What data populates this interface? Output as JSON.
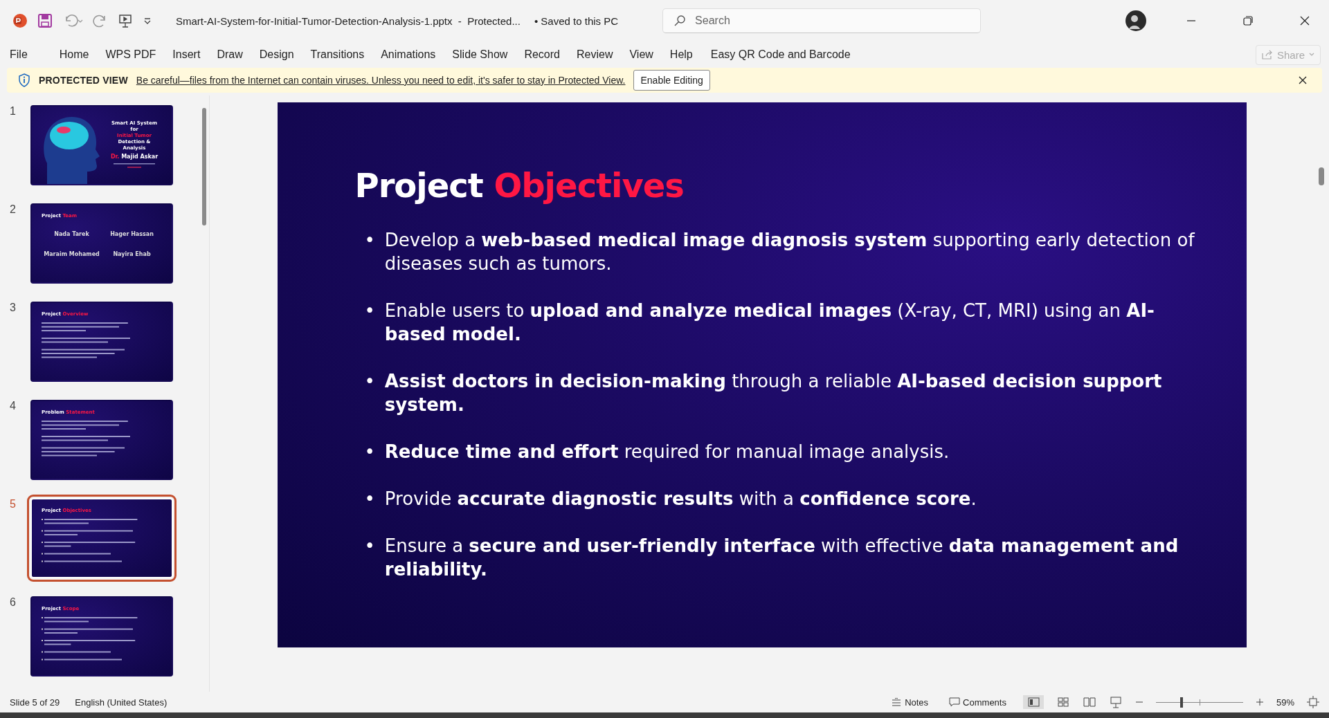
{
  "window": {
    "title": "Smart-AI-System-for-Initial-Tumor-Detection-Analysis-1.pptx  -  Protected...",
    "save_status": "•  Saved to this PC"
  },
  "search": {
    "placeholder": "Search"
  },
  "ribbon_tabs": [
    "File",
    "Home",
    "WPS PDF",
    "Insert",
    "Draw",
    "Design",
    "Transitions",
    "Animations",
    "Slide Show",
    "Record",
    "Review",
    "View",
    "Help",
    "Easy QR Code and Barcode"
  ],
  "share_button": "Share",
  "protected_bar": {
    "label": "PROTECTED VIEW",
    "message": "Be careful—files from the Internet can contain viruses. Unless you need to edit, it's safer to stay in Protected View.",
    "button": "Enable Editing"
  },
  "thumbnails": [
    {
      "number": "1",
      "selected": false,
      "kind": "cover",
      "title_lines": [
        {
          "text": "Smart AI System",
          "accent": false
        },
        {
          "text": "for",
          "accent": false
        },
        {
          "text": "Initial Tumor",
          "accent": true
        },
        {
          "text": "Detection &",
          "accent": false
        },
        {
          "text": "Analysis",
          "accent": false
        }
      ],
      "author_prefix": "Dr.",
      "author": "Majid Askar"
    },
    {
      "number": "2",
      "selected": false,
      "kind": "team",
      "title": "Project",
      "accent": "Team",
      "members": [
        "Nada Tarek",
        "Hager Hassan",
        "Maraim Mohamed",
        "Nayira Ehab"
      ]
    },
    {
      "number": "3",
      "selected": false,
      "kind": "paragraphs",
      "title": "Project",
      "accent": "Overview"
    },
    {
      "number": "4",
      "selected": false,
      "kind": "paragraphs",
      "title": "Problem",
      "accent": "Statement"
    },
    {
      "number": "5",
      "selected": true,
      "kind": "bullets",
      "title": "Project",
      "accent": "Objectives"
    },
    {
      "number": "6",
      "selected": false,
      "kind": "bullets",
      "title": "Project",
      "accent": "Scope"
    }
  ],
  "slide": {
    "title": "Project",
    "accent": "Objectives",
    "bullet_marker": "•",
    "bullets": [
      "Develop a **web-based medical image diagnosis system** supporting early detection of diseases such as tumors.",
      "Enable users to **upload and analyze medical images** (X-ray, CT, MRI) using an **AI-based model.**",
      "**Assist doctors in decision-making** through a reliable **AI-based decision support system.**",
      "**Reduce time and effort** required for manual image analysis.",
      "Provide **accurate diagnostic results** with a **confidence score**.",
      "Ensure a **secure and user-friendly interface** with effective **data management and reliability.**"
    ]
  },
  "status_bar": {
    "slide_info": "Slide 5 of 29",
    "language": "English (United States)",
    "notes": "Notes",
    "comments": "Comments",
    "zoom": "59%",
    "zoom_slider": {
      "level": 0.29
    }
  }
}
